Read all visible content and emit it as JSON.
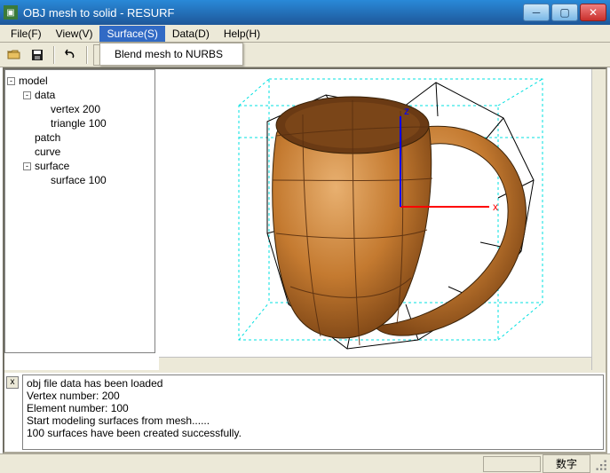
{
  "titlebar": {
    "title": "OBJ mesh to solid - RESURF"
  },
  "menu": {
    "items": [
      {
        "label": "File(F)"
      },
      {
        "label": "View(V)"
      },
      {
        "label": "Surface(S)",
        "active": true
      },
      {
        "label": "Data(D)"
      },
      {
        "label": "Help(H)"
      }
    ],
    "submenu": {
      "items": [
        {
          "label": "Blend mesh to NURBS"
        }
      ]
    }
  },
  "tree": {
    "nodes": [
      {
        "depth": 0,
        "label": "model",
        "exp": "-"
      },
      {
        "depth": 1,
        "label": "data",
        "exp": "-"
      },
      {
        "depth": 2,
        "label": "vertex 200",
        "exp": ""
      },
      {
        "depth": 2,
        "label": "triangle 100",
        "exp": ""
      },
      {
        "depth": 1,
        "label": "patch",
        "exp": ""
      },
      {
        "depth": 1,
        "label": "curve",
        "exp": ""
      },
      {
        "depth": 1,
        "label": "surface",
        "exp": "-"
      },
      {
        "depth": 2,
        "label": "surface 100",
        "exp": ""
      }
    ]
  },
  "viewport": {
    "axis_x": "x",
    "axis_z": "z"
  },
  "log": {
    "lines": [
      "obj file data has been loaded",
      "Vertex number: 200",
      "Element number: 100",
      "Start modeling surfaces from mesh......",
      "100 surfaces have been created successfully."
    ]
  },
  "status": {
    "right": "数字"
  }
}
